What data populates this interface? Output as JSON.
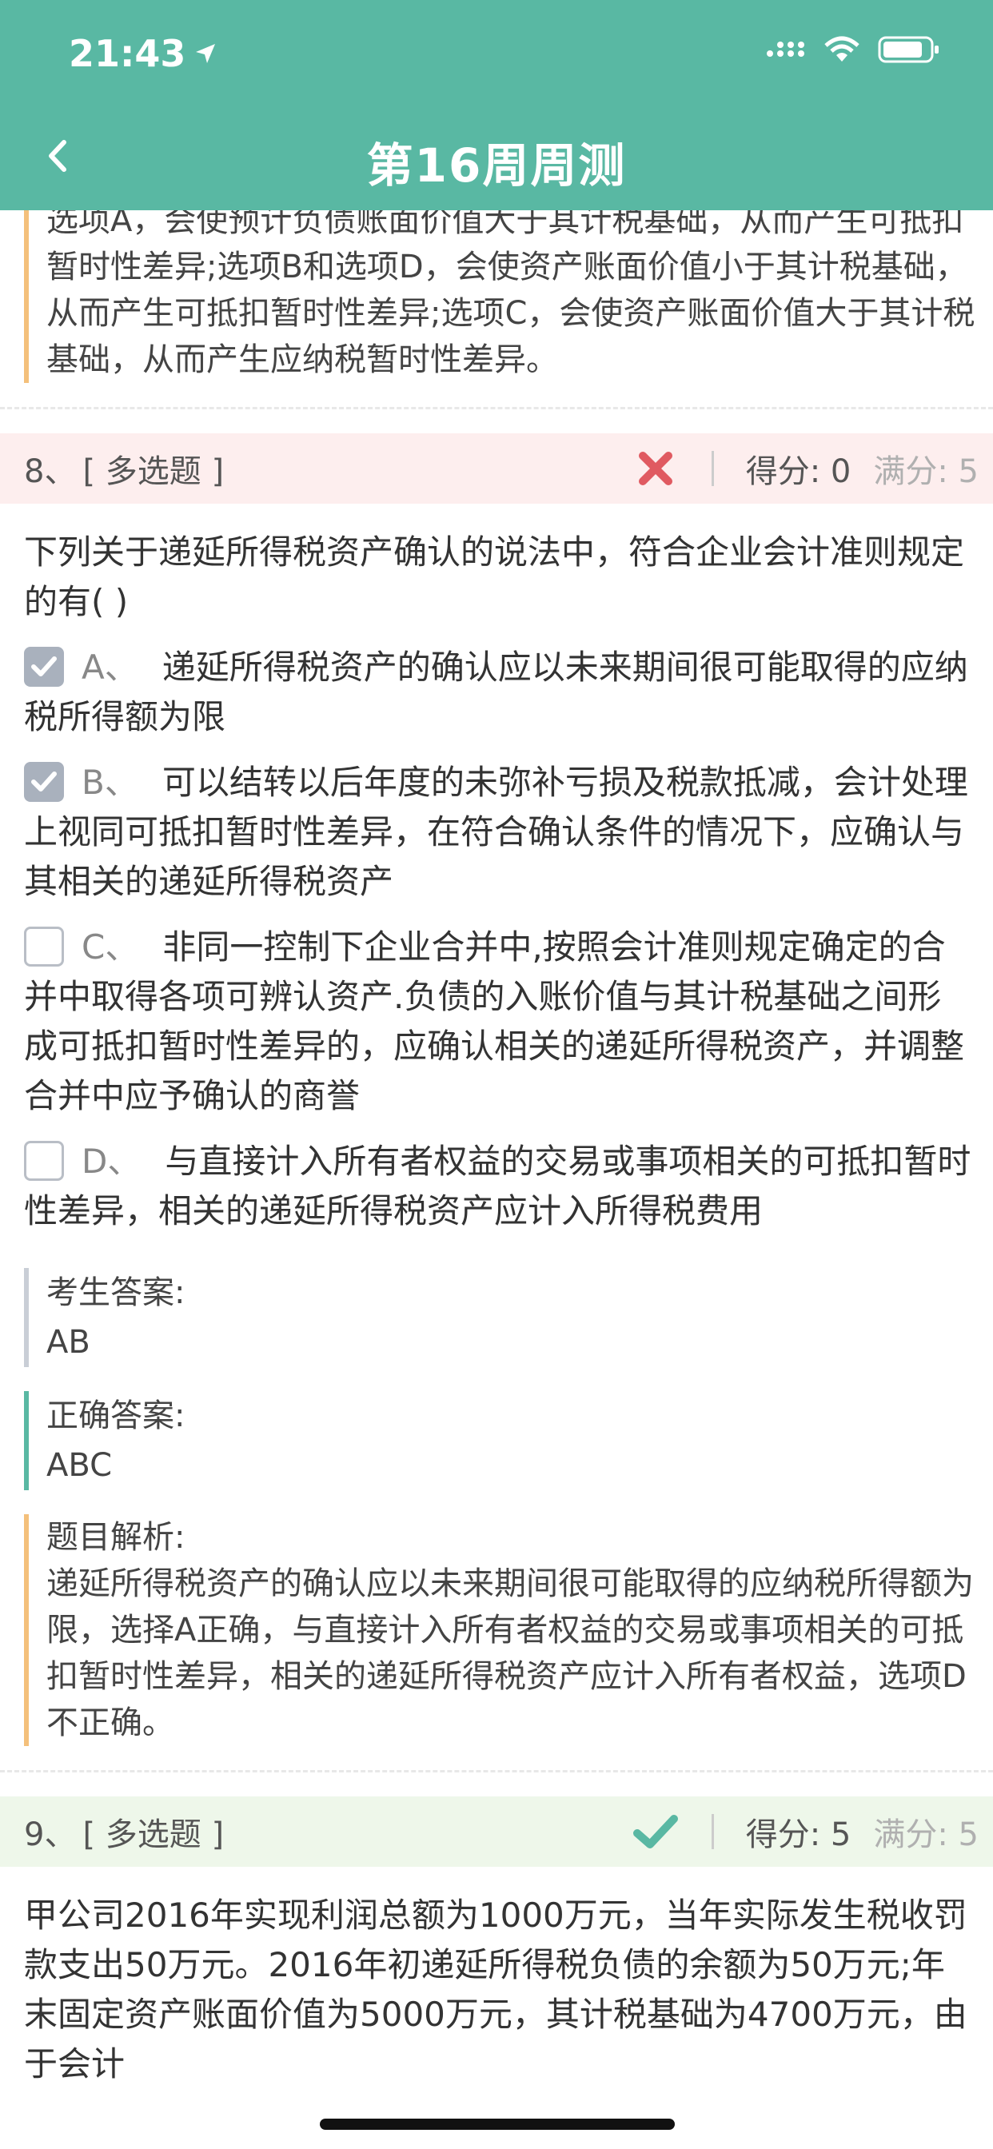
{
  "status": {
    "time": "21:43"
  },
  "header": {
    "title": "第16周周测"
  },
  "prev_analysis": "选项A，会使预计负债账面价值大于其计税基础，从而产生可抵扣暂时性差异;选项B和选项D，会使资产账面价值小于其计税基础，从而产生可抵扣暂时性差异;选项C，会使资产账面价值大于其计税基础，从而产生应纳税暂时性差异。",
  "q8": {
    "number": "8、",
    "type": "[ 多选题 ]",
    "score": "得分: 0",
    "full": "满分: 5",
    "question": "下列关于递延所得税资产确认的说法中，符合企业会计准则规定的有( )",
    "options": [
      {
        "letter": "A、",
        "text": "递延所得税资产的确认应以未来期间很可能取得的应纳税所得额为限",
        "checked": true
      },
      {
        "letter": "B、",
        "text": "可以结转以后年度的未弥补亏损及税款抵减，会计处理上视同可抵扣暂时性差异，在符合确认条件的情况下，应确认与其相关的递延所得税资产",
        "checked": true
      },
      {
        "letter": "C、",
        "text": "非同一控制下企业合并中,按照会计准则规定确定的合并中取得各项可辨认资产.负债的入账价值与其计税基础之间形成可抵扣暂时性差异的，应确认相关的递延所得税资产，并调整合并中应予确认的商誉",
        "checked": false
      },
      {
        "letter": "D、",
        "text": "与直接计入所有者权益的交易或事项相关的可抵扣暂时性差异，相关的递延所得税资产应计入所得税费用",
        "checked": false
      }
    ],
    "student_label": "考生答案:",
    "student_answer": "AB",
    "correct_label": "正确答案:",
    "correct_answer": "ABC",
    "analysis_label": "题目解析:",
    "analysis": "递延所得税资产的确认应以未来期间很可能取得的应纳税所得额为限，选择A正确，与直接计入所有者权益的交易或事项相关的可抵扣暂时性差异，相关的递延所得税资产应计入所有者权益，选项D不正确。"
  },
  "q9": {
    "number": "9、",
    "type": "[ 多选题 ]",
    "score": "得分: 5",
    "full": "满分: 5",
    "question": "甲公司2016年实现利润总额为1000万元，当年实际发生税收罚款支出50万元。2016年初递延所得税负债的余额为50万元;年末固定资产账面价值为5000万元，其计税基础为4700万元，由于会计"
  },
  "colors": {
    "header": "#59b8a3",
    "wrong": "#e05a61",
    "right": "#59b8a3"
  }
}
